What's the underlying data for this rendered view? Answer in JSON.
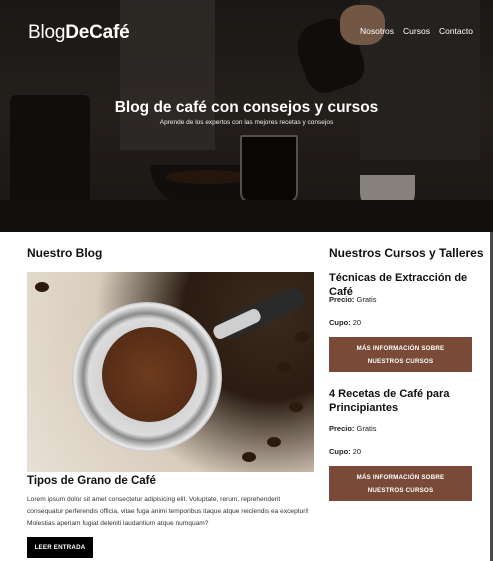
{
  "header": {
    "logo_light": "Blog",
    "logo_bold": "DeCafé",
    "nav": [
      "Nosotros",
      "Cursos",
      "Contacto"
    ]
  },
  "hero": {
    "title": "Blog de café con consejos y cursos",
    "subtitle": "Aprende de los expertos con las mejores recetas y consejos"
  },
  "blog": {
    "section_title": "Nuestro Blog",
    "post": {
      "title": "Tipos de Grano de Café",
      "text": "Lorem ipsum dolor sit amet consectetur adipisicing elit. Voluptate, rerum, reprehenderit consequatur perferendis officia, vitae fuga animi temporibus itaque atque reiciendis ea excepturi! Molestias aperiam fugiat deleniti laudantium atque numquam?",
      "button": "LEER ENTRADA"
    }
  },
  "courses": {
    "section_title": "Nuestros Cursos y Talleres",
    "items": [
      {
        "title": "Técnicas de Extracción de Café",
        "price_label": "Precio:",
        "price": "Gratis",
        "quota_label": "Cupo:",
        "quota": "20",
        "button": "MÁS INFORMACIÓN SOBRE NUESTROS CURSOS"
      },
      {
        "title": "4 Recetas de Café para Principiantes",
        "price_label": "Precio:",
        "price": "Gratis",
        "quota_label": "Cupo:",
        "quota": "20",
        "button": "MÁS INFORMACIÓN SOBRE NUESTROS CURSOS"
      }
    ]
  },
  "colors": {
    "accent_brown": "#784a37",
    "button_dark": "#000000"
  }
}
